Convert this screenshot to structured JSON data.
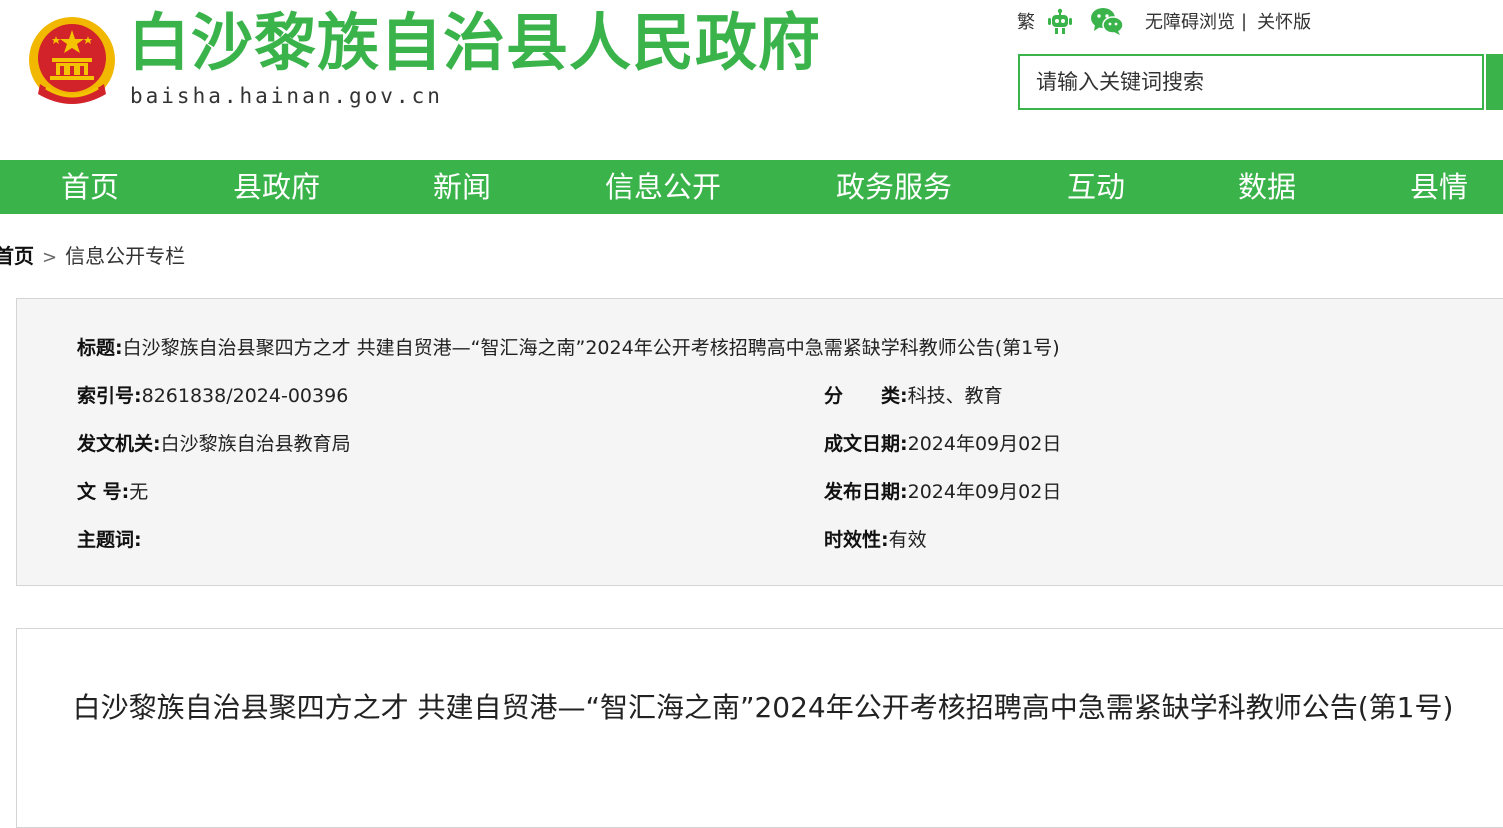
{
  "header": {
    "site_title": "白沙黎族自治县人民政府",
    "site_domain": "baisha.hainan.gov.cn",
    "emblem_icon": "national-emblem-icon"
  },
  "top_links": {
    "traditional": "繁",
    "robot_icon": "robot-icon",
    "wechat_icon": "wechat-icon",
    "accessibility": "无障碍浏览",
    "separator": "|",
    "care_mode": "关怀版"
  },
  "search": {
    "placeholder": "请输入关键词搜索"
  },
  "nav": {
    "items": [
      "首页",
      "县政府",
      "新闻",
      "信息公开",
      "政务服务",
      "互动",
      "数据",
      "县情"
    ]
  },
  "breadcrumb": {
    "home": "首页",
    "arrow": ">",
    "current": "信息公开专栏"
  },
  "info": {
    "title_label": "标题:",
    "title_value": "白沙黎族自治县聚四方之才 共建自贸港—“智汇海之南”2024年公开考核招聘高中急需紧缺学科教师公告(第1号)",
    "index_label": "索引号:",
    "index_value": "8261838/2024-00396",
    "category_label": "分　　类:",
    "category_value": "科技、教育",
    "issuer_label": "发文机关:",
    "issuer_value": "白沙黎族自治县教育局",
    "written_label": "成文日期:",
    "written_value": "2024年09月02日",
    "docno_label": "文 号:",
    "docno_value": "无",
    "published_label": "发布日期:",
    "published_value": "2024年09月02日",
    "keywords_label": "主题词:",
    "keywords_value": "",
    "validity_label": "时效性:",
    "validity_value": "有效"
  },
  "article": {
    "title": "白沙黎族自治县聚四方之才 共建自贸港—“智汇海之南”2024年公开考核招聘高中急需紧缺学科教师公告(第1号)"
  },
  "colors": {
    "brand_green": "#39b34a",
    "emblem_red": "#d2232a",
    "emblem_gold": "#f5c400"
  }
}
